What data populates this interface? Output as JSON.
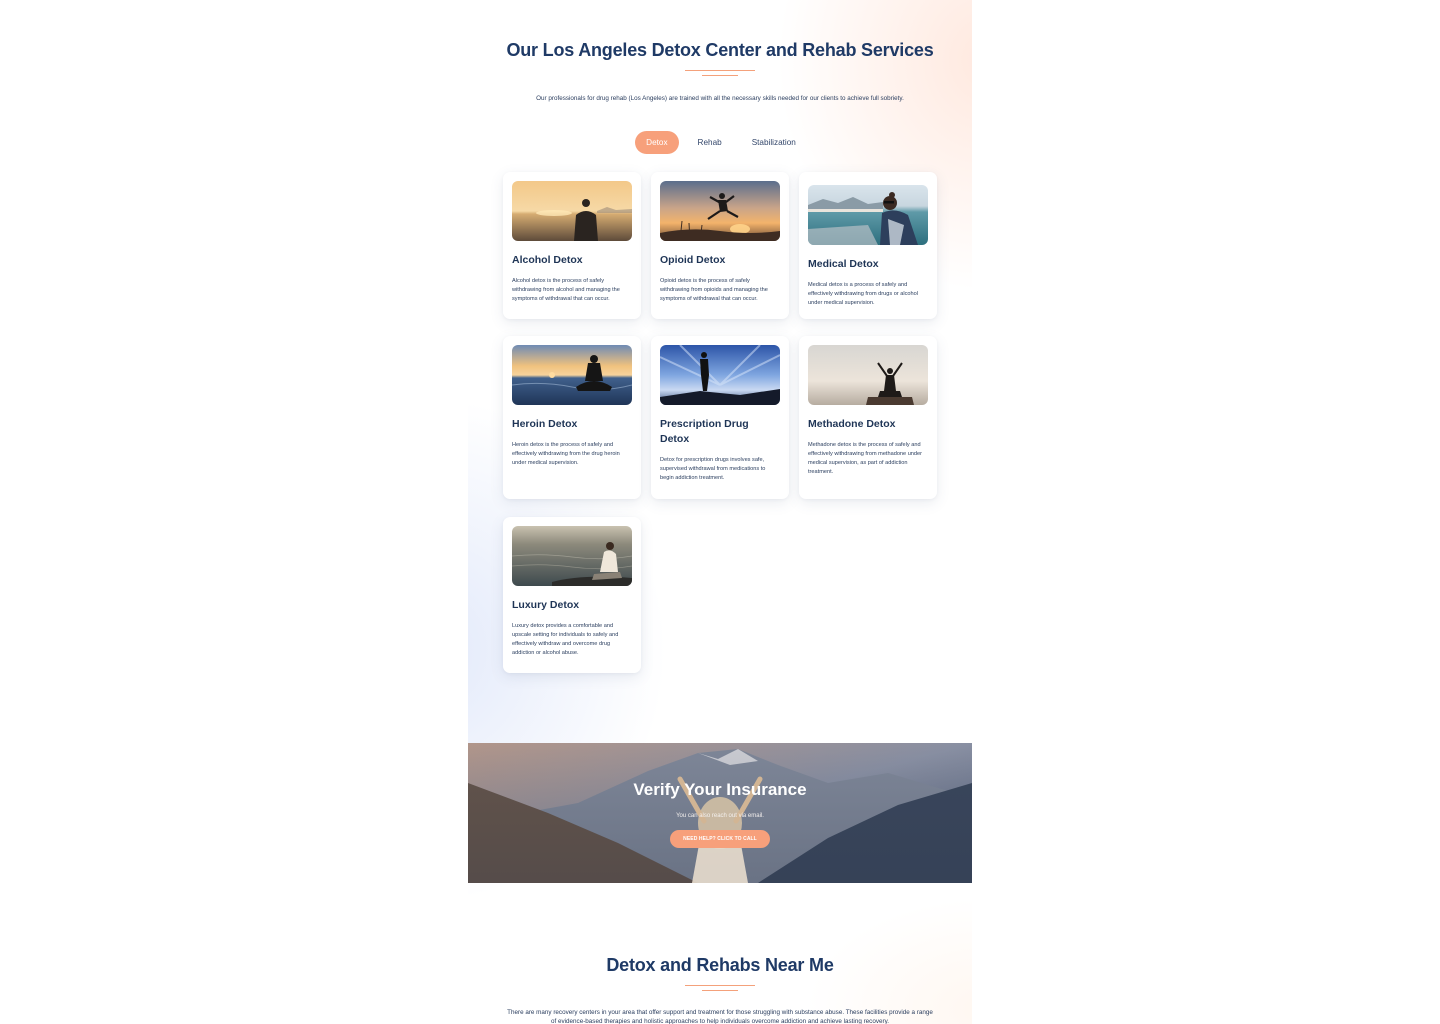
{
  "section": {
    "title": "Our Los Angeles Detox Center and Rehab Services",
    "intro": "Our professionals for drug rehab (Los Angeles) are trained with all the necessary skills needed for our clients to achieve full sobriety."
  },
  "tabs": [
    {
      "label": "Detox",
      "active": true
    },
    {
      "label": "Rehab",
      "active": false
    },
    {
      "label": "Stabilization",
      "active": false
    }
  ],
  "cards": [
    {
      "title": "Alcohol Detox",
      "text": "Alcohol detox is the process of safely withdrawing from alcohol and managing the symptoms of withdrawal that can occur.",
      "image": "sunset-sea-sitting"
    },
    {
      "title": "Opioid Detox",
      "text": "Opioid detox is the process of safely withdrawing from opioids and managing the symptoms of withdrawal that can occur.",
      "image": "sunset-jumping"
    },
    {
      "title": "Medical Detox",
      "text": "Medical detox is a process of safely and effectively withdrawing from drugs or alcohol under medical supervision.",
      "image": "woman-by-coast"
    },
    {
      "title": "Heroin Detox",
      "text": "Heroin detox is the process of safely and effectively withdrawing from the drug heroin under medical supervision.",
      "image": "sunset-meditation"
    },
    {
      "title": "Prescription Drug Detox",
      "text": "Detox for prescription drugs involves safe, supervised withdrawal from medications to begin addiction treatment.",
      "image": "man-on-rock-sky"
    },
    {
      "title": "Methadone Detox",
      "text": "Methadone detox is the process of safely and effectively withdrawing from methadone under medical supervision, as part of addiction treatment.",
      "image": "arms-raised-haze"
    },
    {
      "title": "Luxury Detox",
      "text": "Luxury detox provides a comfortable and upscale setting for individuals to safely and effectively withdraw and overcome drug addiction or alcohol abuse.",
      "image": "woman-by-water"
    }
  ],
  "banner": {
    "title": "Verify Your Insurance",
    "subtitle": "You can also reach out via email.",
    "button": "NEED HELP? CLICK TO CALL"
  },
  "near": {
    "title": "Detox and Rehabs Near Me",
    "text": "There are many recovery centers in your area that offer support and treatment for those struggling with substance abuse. These facilities provide a range of evidence-based therapies and holistic approaches to help individuals overcome addiction and achieve lasting recovery."
  },
  "colors": {
    "accent": "#f7a07b",
    "heading": "#1f3a66",
    "text": "#2a3d5e"
  }
}
